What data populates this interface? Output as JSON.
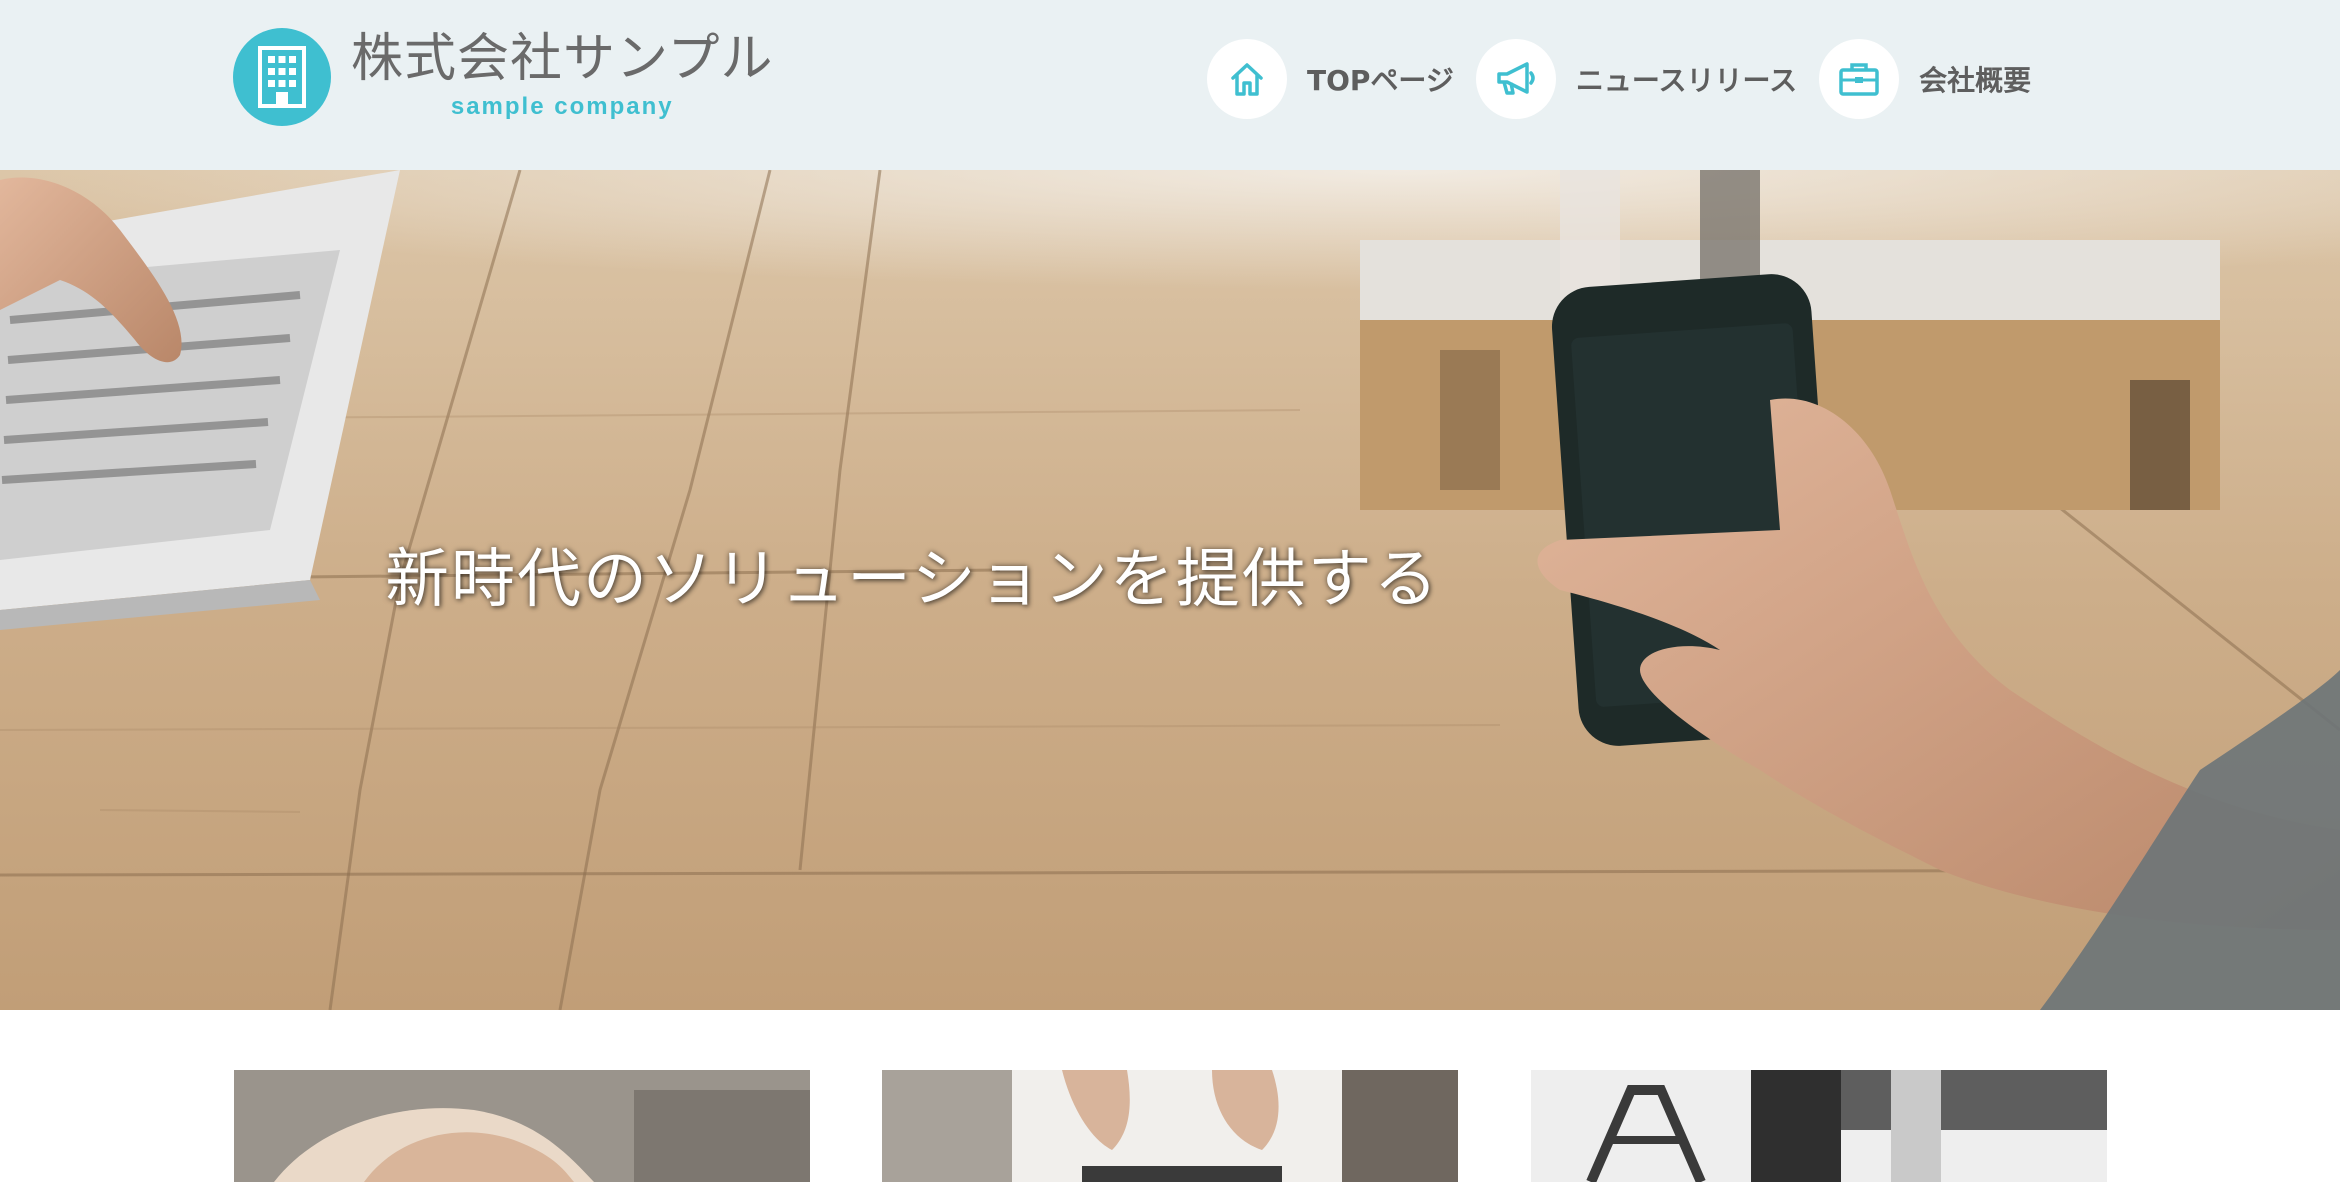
{
  "header": {
    "logo": {
      "name_ja": "株式会社サンプル",
      "name_en": "sample company",
      "icon": "building-icon"
    },
    "nav": [
      {
        "label": "TOPページ",
        "icon": "home-icon"
      },
      {
        "label": "ニュースリリース",
        "icon": "megaphone-icon"
      },
      {
        "label": "会社概要",
        "icon": "briefcase-icon"
      }
    ]
  },
  "hero": {
    "tagline": "新時代のソリューションを提供する"
  },
  "cards": [
    {
      "image": "hands-with-cup-photo"
    },
    {
      "image": "hands-on-laptop-photo"
    },
    {
      "image": "office-interior-photo"
    }
  ],
  "colors": {
    "accent": "#3fbfd0",
    "header_bg": "#eaf1f3",
    "nav_text": "#5e5e5e",
    "logo_text": "#6a6a6a"
  }
}
